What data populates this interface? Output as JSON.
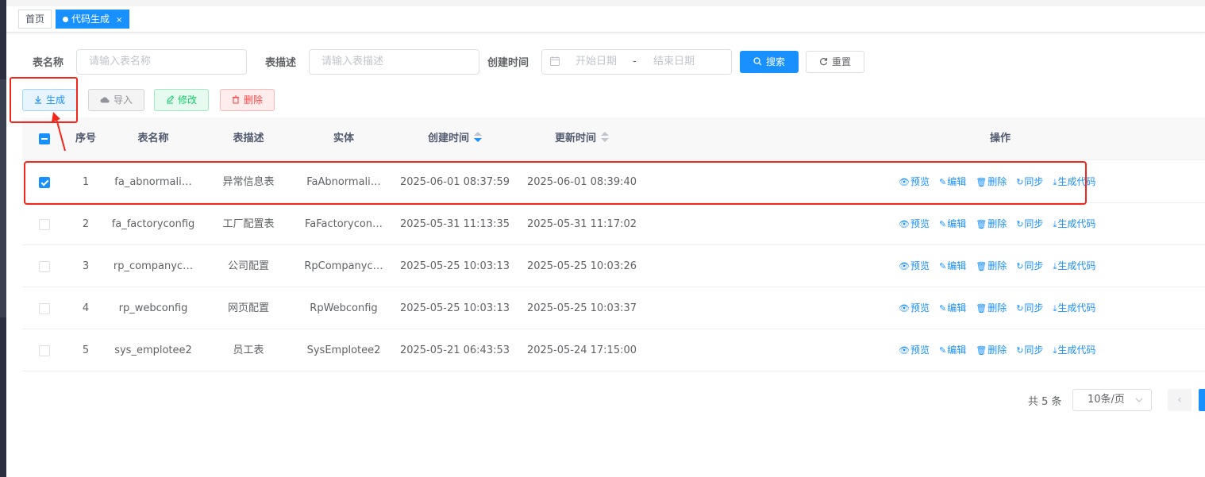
{
  "tabs": [
    {
      "label": "首页"
    },
    {
      "label": "代码生成",
      "close": "×"
    }
  ],
  "search": {
    "table_name_label": "表名称",
    "table_name_placeholder": "请输入表名称",
    "table_desc_label": "表描述",
    "table_desc_placeholder": "请输入表描述",
    "create_time_label": "创建时间",
    "start_date_placeholder": "开始日期",
    "range_separator": "-",
    "end_date_placeholder": "结束日期",
    "search_button": "搜索",
    "reset_button": "重置"
  },
  "toolbar": {
    "generate": "生成",
    "import": "导入",
    "edit": "修改",
    "delete": "删除"
  },
  "table": {
    "headers": {
      "index": "序号",
      "table_name": "表名称",
      "table_desc": "表描述",
      "entity": "实体",
      "create_time": "创建时间",
      "update_time": "更新时间",
      "actions": "操作"
    },
    "action_labels": {
      "preview": "预览",
      "edit": "编辑",
      "delete": "删除",
      "sync": "同步",
      "gen_code": "生成代码"
    },
    "rows": [
      {
        "checked": true,
        "index": "1",
        "table_name": "fa_abnormali…",
        "table_desc": "异常信息表",
        "entity": "FaAbnormali…",
        "create_time": "2025-06-01 08:37:59",
        "update_time": "2025-06-01 08:39:40"
      },
      {
        "checked": false,
        "index": "2",
        "table_name": "fa_factoryconfig",
        "table_desc": "工厂配置表",
        "entity": "FaFactorycon…",
        "create_time": "2025-05-31 11:13:35",
        "update_time": "2025-05-31 11:17:02"
      },
      {
        "checked": false,
        "index": "3",
        "table_name": "rp_companyc…",
        "table_desc": "公司配置",
        "entity": "RpCompanyc…",
        "create_time": "2025-05-25 10:03:13",
        "update_time": "2025-05-25 10:03:26"
      },
      {
        "checked": false,
        "index": "4",
        "table_name": "rp_webconfig",
        "table_desc": "网页配置",
        "entity": "RpWebconfig",
        "create_time": "2025-05-25 10:03:13",
        "update_time": "2025-05-25 10:03:37"
      },
      {
        "checked": false,
        "index": "5",
        "table_name": "sys_emplotee2",
        "table_desc": "员工表",
        "entity": "SysEmplotee2",
        "create_time": "2025-05-21 06:43:53",
        "update_time": "2025-05-24 17:15:00"
      }
    ]
  },
  "pagination": {
    "total": "共 5 条",
    "page_size": "10条/页",
    "prev": "‹"
  },
  "colors": {
    "primary": "#1890ff",
    "success": "#13ce66",
    "danger": "#ff4949",
    "annotation": "#f2271c"
  }
}
